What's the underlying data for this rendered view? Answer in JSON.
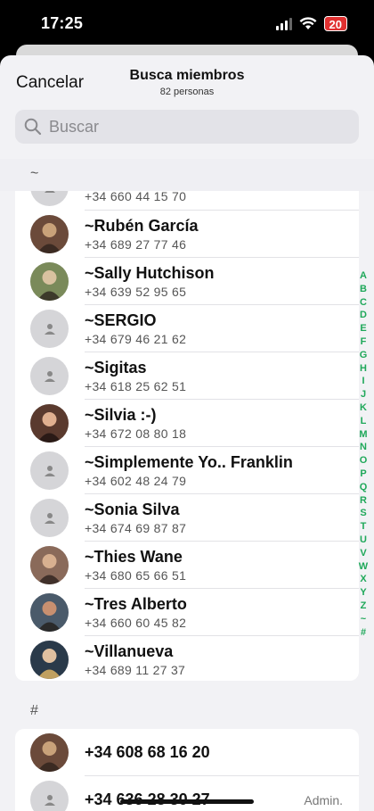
{
  "status": {
    "time": "17:25",
    "battery": "20"
  },
  "header": {
    "cancel": "Cancelar",
    "title": "Busca miembros",
    "subtitle": "82 personas"
  },
  "search": {
    "placeholder": "Buscar"
  },
  "section_tilde": "~",
  "section_hash": "#",
  "partial_row": {
    "phone": "+34 660 44 15 70"
  },
  "contacts": [
    {
      "name": "~Rubén García",
      "phone": "+34 689 27 77 46",
      "avatar": "photo"
    },
    {
      "name": "~Sally Hutchison",
      "phone": "+34 639 52 95 65",
      "avatar": "photo"
    },
    {
      "name": "~SERGIO",
      "phone": "+34 679 46 21 62",
      "avatar": "placeholder"
    },
    {
      "name": "~Sigitas",
      "phone": "+34 618 25 62 51",
      "avatar": "placeholder"
    },
    {
      "name": "~Silvia  :-)",
      "phone": "+34 672 08 80 18",
      "avatar": "photo"
    },
    {
      "name": "~Simplemente Yo.. Franklin",
      "phone": "+34 602 48 24 79",
      "avatar": "placeholder"
    },
    {
      "name": "~Sonia Silva",
      "phone": "+34 674 69 87 87",
      "avatar": "placeholder"
    },
    {
      "name": "~Thies Wane",
      "phone": "+34 680 65 66 51",
      "avatar": "photo"
    },
    {
      "name": "~Tres Alberto",
      "phone": "+34 660 60 45 82",
      "avatar": "photo"
    },
    {
      "name": "~Villanueva",
      "phone": "+34 689 11 27 37",
      "avatar": "photo"
    }
  ],
  "hash_contacts": [
    {
      "number": "+34 608 68 16 20",
      "avatar": "photo",
      "badge": ""
    },
    {
      "number": "+34 636 28 30 27",
      "avatar": "placeholder",
      "badge": "Admin."
    }
  ],
  "index_letters": [
    "A",
    "B",
    "C",
    "D",
    "E",
    "F",
    "G",
    "H",
    "I",
    "J",
    "K",
    "L",
    "M",
    "N",
    "O",
    "P",
    "Q",
    "R",
    "S",
    "T",
    "U",
    "V",
    "W",
    "X",
    "Y",
    "Z",
    "~",
    "#"
  ],
  "colors": {
    "accent": "#1fa85a",
    "battery": "#e03030"
  }
}
